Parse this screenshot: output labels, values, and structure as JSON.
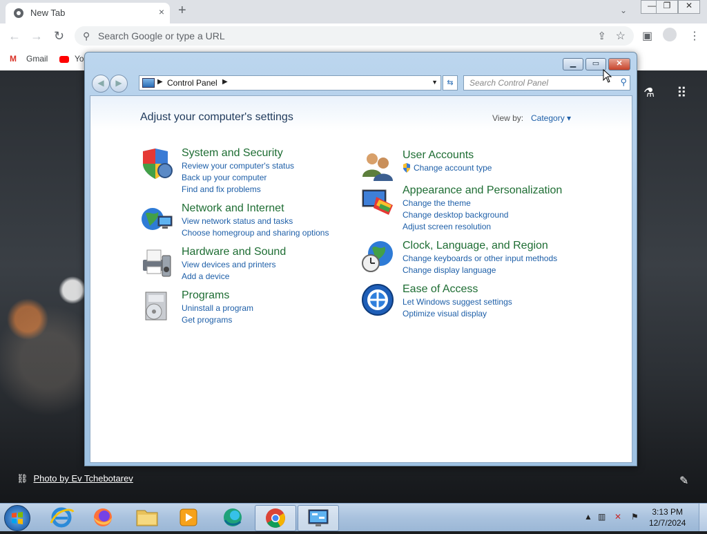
{
  "browser": {
    "tab_title": "New Tab",
    "tab_close": "×",
    "new_tab": "+",
    "omnibox_placeholder": "Search Google or type a URL",
    "bookmarks": [
      "Gmail",
      "Yo"
    ]
  },
  "desktop": {
    "photo_credit": "Photo by Ev Tchebotarev"
  },
  "control_panel": {
    "breadcrumb": "Control Panel",
    "search_placeholder": "Search Control Panel",
    "heading": "Adjust your computer's settings",
    "view_by_label": "View by:",
    "view_by_value": "Category",
    "categories_left": [
      {
        "title": "System and Security",
        "icon": "shield-icon",
        "links": [
          "Review your computer's status",
          "Back up your computer",
          "Find and fix problems"
        ]
      },
      {
        "title": "Network and Internet",
        "icon": "network-icon",
        "links": [
          "View network status and tasks",
          "Choose homegroup and sharing options"
        ]
      },
      {
        "title": "Hardware and Sound",
        "icon": "printer-icon",
        "links": [
          "View devices and printers",
          "Add a device"
        ]
      },
      {
        "title": "Programs",
        "icon": "programs-icon",
        "links": [
          "Uninstall a program",
          "Get programs"
        ]
      }
    ],
    "categories_right": [
      {
        "title": "User Accounts",
        "icon": "users-icon",
        "links": [
          "Change account type"
        ]
      },
      {
        "title": "Appearance and Personalization",
        "icon": "appearance-icon",
        "links": [
          "Change the theme",
          "Change desktop background",
          "Adjust screen resolution"
        ]
      },
      {
        "title": "Clock, Language, and Region",
        "icon": "globe-clock-icon",
        "links": [
          "Change keyboards or other input methods",
          "Change display language"
        ]
      },
      {
        "title": "Ease of Access",
        "icon": "ease-of-access-icon",
        "links": [
          "Let Windows suggest settings",
          "Optimize visual display"
        ]
      }
    ]
  },
  "taskbar": {
    "time": "3:13 PM",
    "date": "12/7/2024",
    "items": [
      "internet-explorer-icon",
      "firefox-icon",
      "explorer-folder-icon",
      "media-player-icon",
      "edge-icon",
      "chrome-icon",
      "control-panel-icon"
    ]
  }
}
